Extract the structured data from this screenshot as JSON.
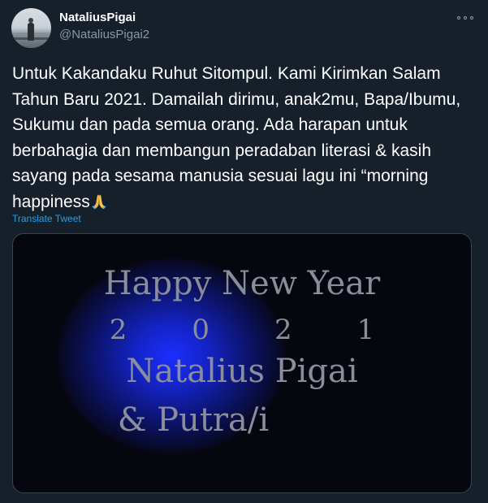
{
  "author": {
    "name": "NataliusPigai",
    "handle": "@NataliusPigai2",
    "avatar_icon": "profile-photo-person-on-ship"
  },
  "more_icon": "more-options-icon",
  "tweet": {
    "text": "Untuk Kakandaku Ruhut Sitompul. Kami Kirimkan Salam Tahun Baru 2021. Damailah dirimu, anak2mu, Bapa/Ibumu, Sukumu dan pada semua orang. Ada harapan untuk berbahagia dan membangun peradaban literasi & kasih sayang pada sesama manusia sesuai lagu ini “morning happiness",
    "emoji": "folded-hands-emoji"
  },
  "translate_label": "Translate Tweet",
  "media": {
    "line1": "Happy New Year",
    "line2": "2021",
    "line3": "Natalius Pigai",
    "line4": "& Putra/i"
  },
  "colors": {
    "background": "#15202b",
    "text": "#ffffff",
    "secondary_text": "#8899a6",
    "link": "#1da1f2",
    "media_glow": "#1c2eff"
  }
}
